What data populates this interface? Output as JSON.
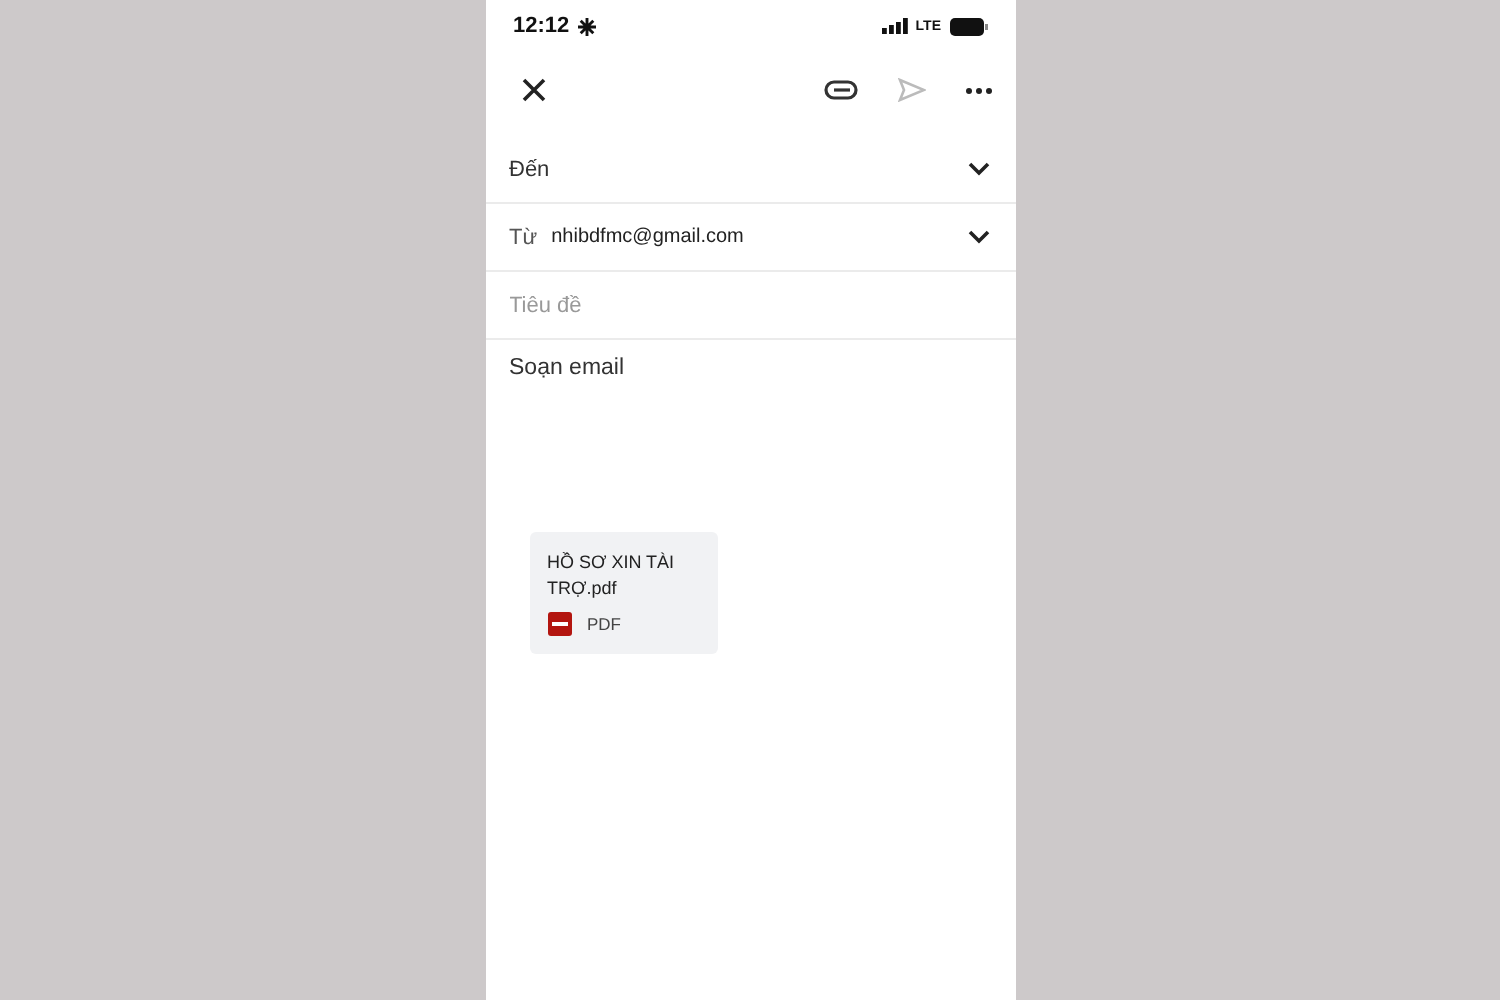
{
  "status_bar": {
    "time": "12:12",
    "network": "LTE"
  },
  "toolbar": {
    "send_disabled": true
  },
  "to": {
    "label": "Đến"
  },
  "from": {
    "label": "Từ",
    "value": "nhibdfmc@gmail.com"
  },
  "subject": {
    "placeholder": "Tiêu đề"
  },
  "body": {
    "placeholder": "Soạn email"
  },
  "attachment": {
    "name": "HỒ SƠ XIN TÀI TRỢ.pdf",
    "type": "PDF"
  }
}
